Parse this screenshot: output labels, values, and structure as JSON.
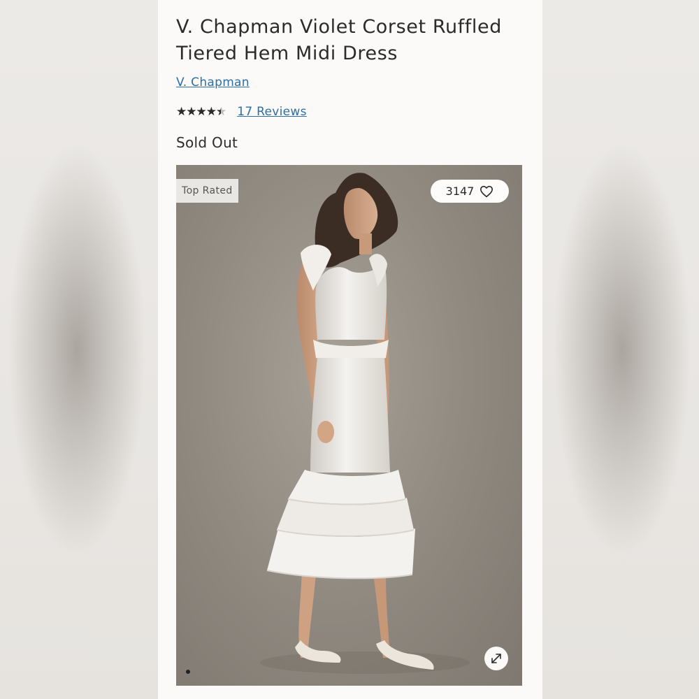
{
  "product": {
    "title": "V. Chapman Violet Corset Ruffled Tiered Hem Midi Dress",
    "brand": "V. Chapman",
    "rating": 4.5,
    "rating_max": 5,
    "stars_glyphs": "★★★★★",
    "reviews_label": "17 Reviews",
    "status": "Sold Out"
  },
  "image": {
    "badge": "Top Rated",
    "favorites_count": "3147",
    "favorite_icon": "heart-icon",
    "expand_icon": "expand-arrows-icon",
    "carousel_dots": 1,
    "active_dot": 0
  },
  "colors": {
    "link": "#2d6ea3",
    "text": "#2b2b2b",
    "panel": "#fbfaf8"
  }
}
